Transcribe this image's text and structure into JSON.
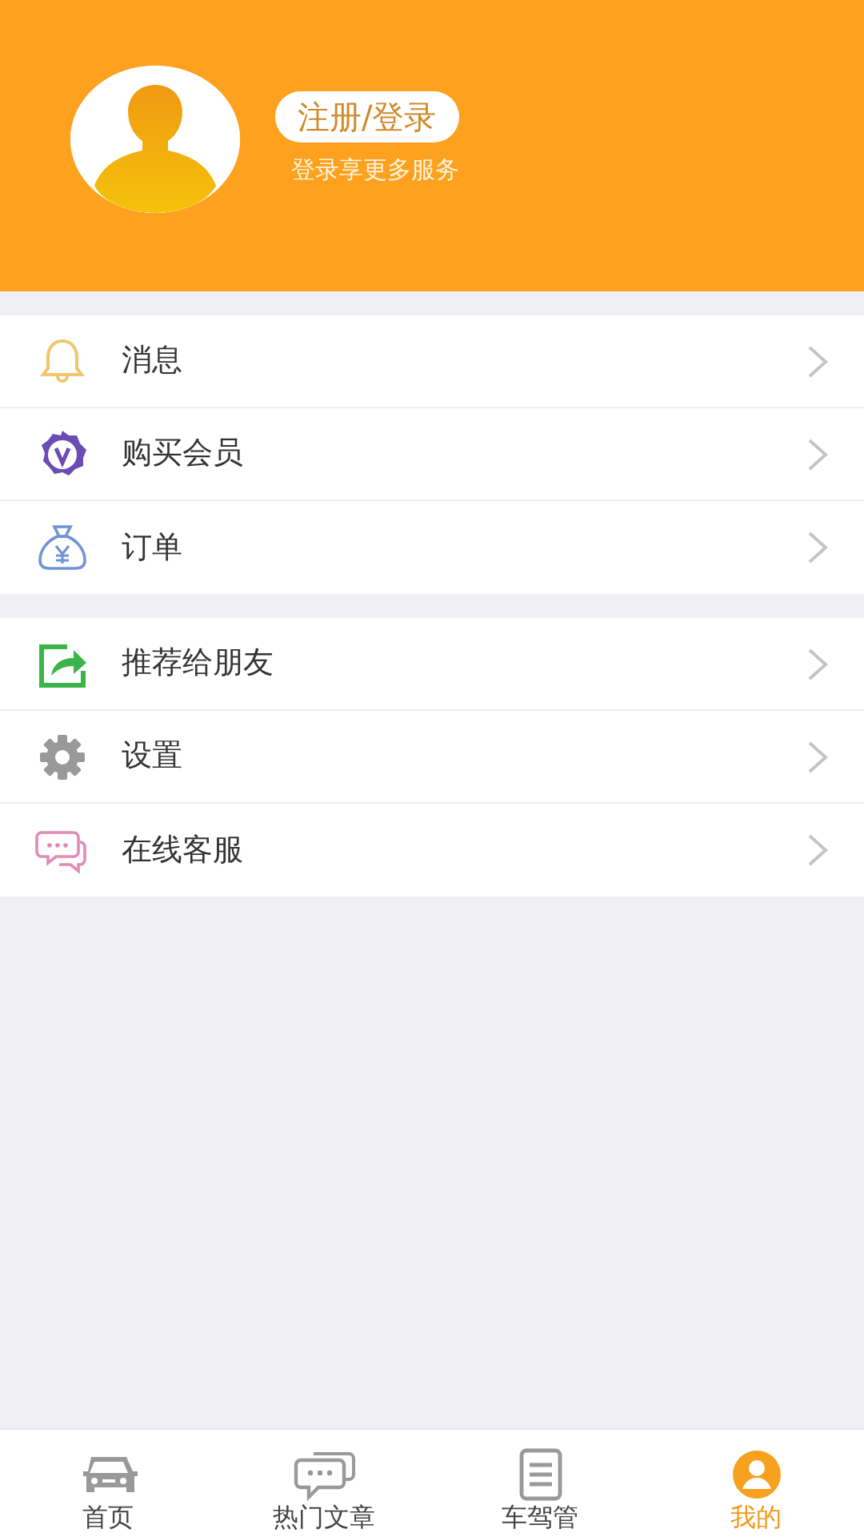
{
  "header": {
    "login_button": "注册/登录",
    "subtitle": "登录享更多服务"
  },
  "menu_groups": [
    {
      "items": [
        {
          "label": "消息"
        },
        {
          "label": "购买会员"
        },
        {
          "label": "订单"
        }
      ]
    },
    {
      "items": [
        {
          "label": "推荐给朋友"
        },
        {
          "label": "设置"
        },
        {
          "label": "在线客服"
        }
      ]
    }
  ],
  "tab_bar": [
    {
      "label": "首页",
      "selected": false
    },
    {
      "label": "热门文章",
      "selected": false
    },
    {
      "label": "车驾管",
      "selected": false
    },
    {
      "label": "我的",
      "selected": true
    }
  ]
}
